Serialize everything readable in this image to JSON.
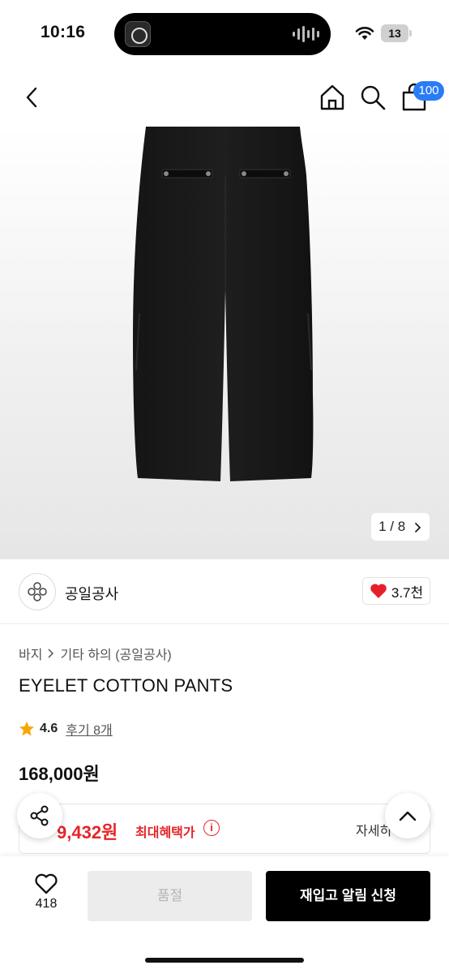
{
  "status_bar": {
    "time": "10:16",
    "battery": "13"
  },
  "header": {
    "cart_badge": "100"
  },
  "gallery": {
    "counter": "1 / 8"
  },
  "brand": {
    "name": "공일공사",
    "likes": "3.7천"
  },
  "product": {
    "breadcrumb": [
      "바지",
      "기타 하의 (공일공사)"
    ],
    "title": "EYELET COTTON PANTS",
    "rating": "4.6",
    "reviews": "후기 8개",
    "price": "168,000원"
  },
  "benefit": {
    "price": "9,432원",
    "label": "최대혜택가",
    "detail": "자세히"
  },
  "bottom_bar": {
    "wish_count": "418",
    "soldout_label": "품절",
    "restock_label": "재입고 알림 신청"
  },
  "colors": {
    "accent_blue": "#2a7cf6",
    "benefit_red": "#e5252a",
    "heart_red": "#e6202b",
    "star_gold": "#f7a600"
  },
  "icons": [
    "back-icon",
    "home-icon",
    "search-icon",
    "cart-icon",
    "chevron-right-icon",
    "brand-logo-icon",
    "heart-icon",
    "star-icon",
    "info-icon",
    "share-icon",
    "chevron-up-icon",
    "wifi-icon"
  ]
}
